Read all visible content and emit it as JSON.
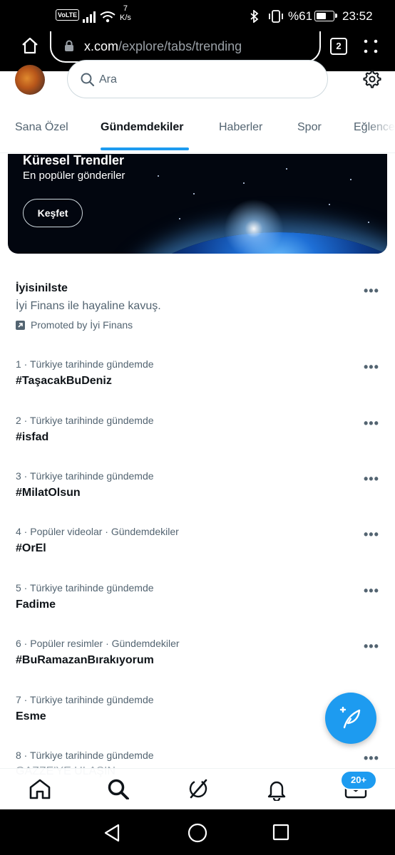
{
  "status_bar": {
    "volte": "VoLTE",
    "net_speed_value": "7",
    "net_speed_unit": "K/s",
    "battery": "%61",
    "battery_level": 0.61,
    "time": "23:52"
  },
  "browser": {
    "url_host": "x.com",
    "url_path": "/explore/tabs/trending",
    "tab_count": "2"
  },
  "search": {
    "placeholder": "Ara"
  },
  "tabs": [
    {
      "label": "Sana Özel"
    },
    {
      "label": "Gündemdekiler",
      "active": true
    },
    {
      "label": "Haberler"
    },
    {
      "label": "Spor"
    },
    {
      "label": "Eğlence"
    }
  ],
  "banner": {
    "title": "Küresel Trendler",
    "subtitle": "En popüler gönderiler",
    "button": "Keşfet"
  },
  "promoted": {
    "name": "İyisinilste",
    "description": "İyi Finans ile hayaline kavuş.",
    "tag": "Promoted by İyi Finans"
  },
  "trends": [
    {
      "rank": "1",
      "context": "Türkiye tarihinde gündemde",
      "title": "#TaşacakBuDeniz"
    },
    {
      "rank": "2",
      "context": "Türkiye tarihinde gündemde",
      "title": "#isfad"
    },
    {
      "rank": "3",
      "context": "Türkiye tarihinde gündemde",
      "title": "#MilatOlsun"
    },
    {
      "rank": "4",
      "context": "Popüler videolar · Gündemdekiler",
      "title": "#OrEl"
    },
    {
      "rank": "5",
      "context": "Türkiye tarihinde gündemde",
      "title": "Fadime"
    },
    {
      "rank": "6",
      "context": "Popüler resimler · Gündemdekiler",
      "title": "#BuRamazanBırakıyorum"
    },
    {
      "rank": "7",
      "context": "Türkiye tarihinde gündemde",
      "title": "Esme"
    },
    {
      "rank": "8",
      "context": "Türkiye tarihinde gündemde",
      "title": "GAZZE'YE ULAŞIN"
    }
  ],
  "more_glyph": "•••",
  "bottom_nav": {
    "messages_badge": "20+"
  },
  "colors": {
    "accent": "#1d9bf0",
    "text": "#0f1419",
    "secondary": "#536471"
  }
}
